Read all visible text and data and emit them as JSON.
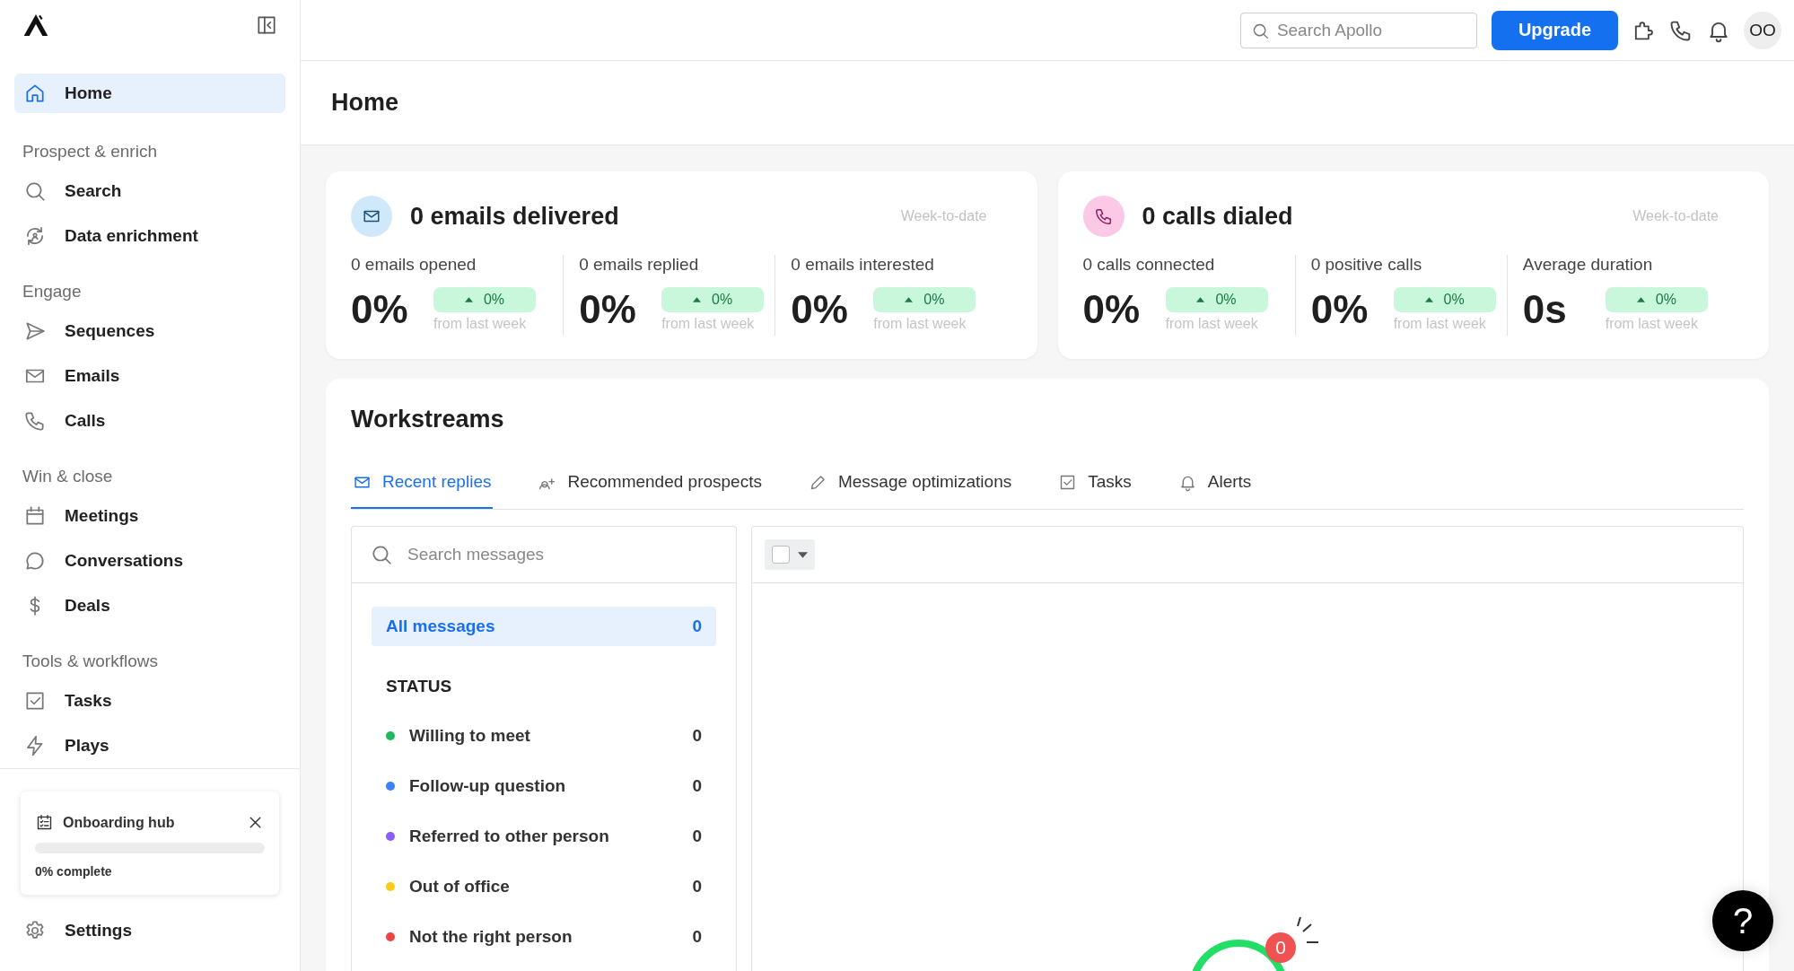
{
  "sidebar": {
    "sections": [
      {
        "items": [
          {
            "label": "Home",
            "selected": true
          }
        ]
      },
      {
        "title": "Prospect & enrich",
        "items": [
          {
            "label": "Search",
            "selected": false
          },
          {
            "label": "Data enrichment",
            "selected": false
          }
        ]
      },
      {
        "title": "Engage",
        "items": [
          {
            "label": "Sequences",
            "selected": false
          },
          {
            "label": "Emails",
            "selected": false
          },
          {
            "label": "Calls",
            "selected": false
          }
        ]
      },
      {
        "title": "Win & close",
        "items": [
          {
            "label": "Meetings",
            "selected": false
          },
          {
            "label": "Conversations",
            "selected": false
          },
          {
            "label": "Deals",
            "selected": false
          }
        ]
      },
      {
        "title": "Tools & workflows",
        "items": [
          {
            "label": "Tasks",
            "selected": false
          },
          {
            "label": "Plays",
            "selected": false
          }
        ]
      }
    ],
    "onboarding": {
      "title": "Onboarding hub",
      "level": 0,
      "caption": "0% complete"
    },
    "settings": "Settings"
  },
  "topbar": {
    "search_placeholder": "Search Apollo",
    "upgrade": "Upgrade",
    "avatar": "OO"
  },
  "page_title": "Home",
  "cards": [
    {
      "kind": "email",
      "title": "0 emails delivered",
      "period": "Week-to-date",
      "metrics": [
        {
          "label": "0 emails opened",
          "value": "0%",
          "change": "0%",
          "note": "from last week"
        },
        {
          "label": "0 emails replied",
          "value": "0%",
          "change": "0%",
          "note": "from last week"
        },
        {
          "label": "0 emails interested",
          "value": "0%",
          "change": "0%",
          "note": "from last week"
        }
      ]
    },
    {
      "kind": "call",
      "title": "0 calls dialed",
      "period": "Week-to-date",
      "metrics": [
        {
          "label": "0 calls connected",
          "value": "0%",
          "change": "0%",
          "note": "from last week"
        },
        {
          "label": "0 positive calls",
          "value": "0%",
          "change": "0%",
          "note": "from last week"
        },
        {
          "label": "Average duration",
          "value": "0s",
          "change": "0%",
          "note": "from last week"
        }
      ]
    }
  ],
  "workstreams": {
    "title": "Workstreams",
    "tabs": [
      {
        "label": "Recent replies",
        "selected": true
      },
      {
        "label": "Recommended prospects",
        "selected": false
      },
      {
        "label": "Message optimizations",
        "selected": false
      },
      {
        "label": "Tasks",
        "selected": false
      },
      {
        "label": "Alerts",
        "selected": false
      }
    ],
    "search_placeholder": "Search messages",
    "all": {
      "label": "All messages",
      "count": "0",
      "selected": true
    },
    "status_heading": "STATUS",
    "statuses": [
      {
        "label": "Willing to meet",
        "count": "0",
        "color": "#1fb85a"
      },
      {
        "label": "Follow-up question",
        "count": "0",
        "color": "#3b82f6"
      },
      {
        "label": "Referred to other person",
        "count": "0",
        "color": "#8b5cf6"
      },
      {
        "label": "Out of office",
        "count": "0",
        "color": "#facc15"
      },
      {
        "label": "Not the right person",
        "count": "0",
        "color": "#ef4444"
      }
    ],
    "select_all": {
      "checked": false
    },
    "empty_badge": "0"
  },
  "help": "?"
}
